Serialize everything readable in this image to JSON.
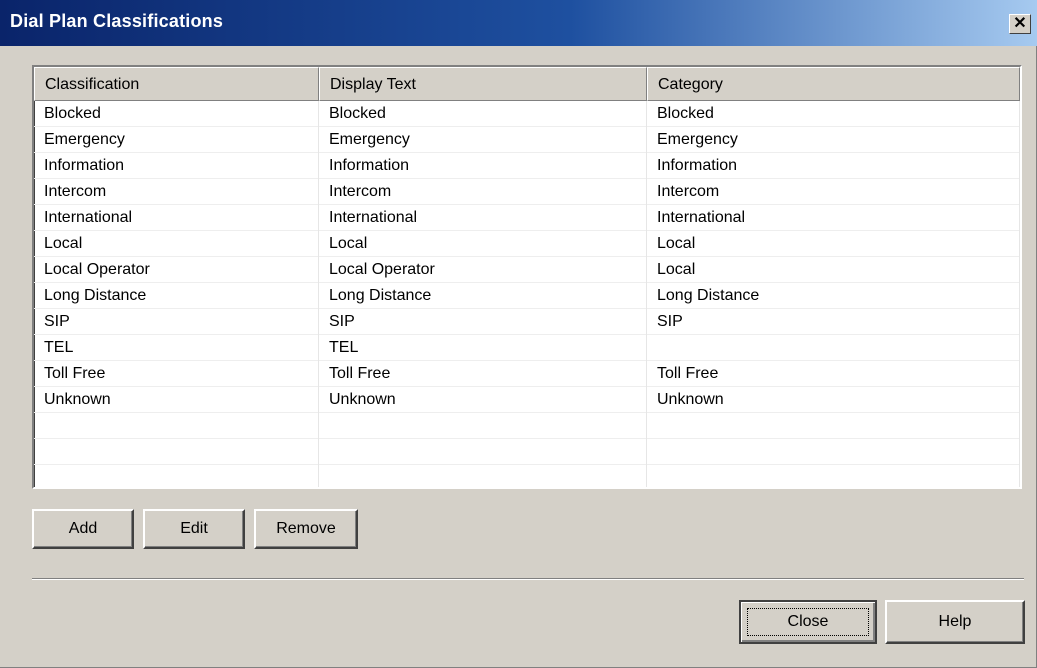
{
  "window": {
    "title": "Dial Plan Classifications",
    "close_glyph": "✕"
  },
  "table": {
    "columns": [
      "Classification",
      "Display Text",
      "Category"
    ],
    "rows": [
      [
        "Blocked",
        "Blocked",
        "Blocked"
      ],
      [
        "Emergency",
        "Emergency",
        "Emergency"
      ],
      [
        "Information",
        "Information",
        "Information"
      ],
      [
        "Intercom",
        "Intercom",
        "Intercom"
      ],
      [
        "International",
        "International",
        "International"
      ],
      [
        "Local",
        "Local",
        "Local"
      ],
      [
        "Local Operator",
        "Local Operator",
        "Local"
      ],
      [
        "Long Distance",
        "Long Distance",
        "Long Distance"
      ],
      [
        "SIP",
        "SIP",
        "SIP"
      ],
      [
        "TEL",
        "TEL",
        ""
      ],
      [
        "Toll Free",
        "Toll Free",
        "Toll Free"
      ],
      [
        "Unknown",
        "Unknown",
        "Unknown"
      ],
      [
        "",
        "",
        ""
      ],
      [
        "",
        "",
        ""
      ],
      [
        "",
        "",
        ""
      ]
    ]
  },
  "buttons": {
    "add": "Add",
    "edit": "Edit",
    "remove": "Remove",
    "close": "Close",
    "help": "Help"
  }
}
